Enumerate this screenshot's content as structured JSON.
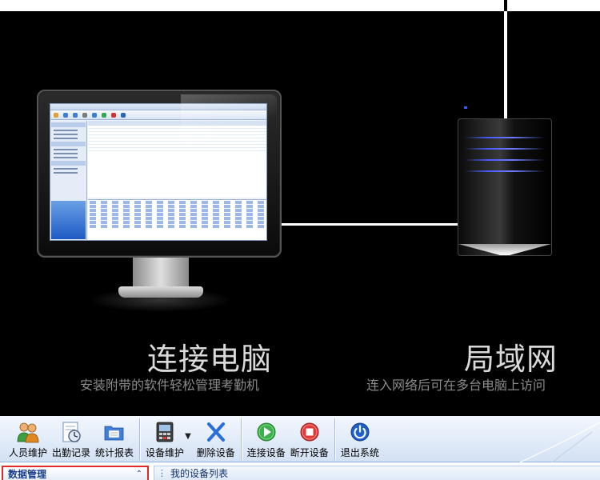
{
  "promo": {
    "left": {
      "title": "连接电脑",
      "subtitle": "安装附带的软件轻松管理考勤机"
    },
    "right": {
      "title": "局域网",
      "subtitle": "连入网络后可在多台电脑上访问"
    }
  },
  "toolbar": {
    "groups": [
      [
        {
          "name": "personnel-button",
          "label": "人员维护",
          "icon": "people-icon"
        },
        {
          "name": "attendance-record-button",
          "label": "出勤记录",
          "icon": "clock-document-icon"
        },
        {
          "name": "stats-report-button",
          "label": "统计报表",
          "icon": "folder-report-icon"
        }
      ],
      [
        {
          "name": "device-maintenance-button",
          "label": "设备维护",
          "icon": "attendance-device-icon"
        },
        {
          "name": "delete-device-button",
          "label": "删除设备",
          "icon": "blue-x-icon"
        }
      ],
      [
        {
          "name": "connect-device-button",
          "label": "连接设备",
          "icon": "green-play-icon"
        },
        {
          "name": "disconnect-device-button",
          "label": "断开设备",
          "icon": "red-stop-icon"
        }
      ],
      [
        {
          "name": "exit-system-button",
          "label": "退出系统",
          "icon": "power-icon"
        }
      ]
    ]
  },
  "panels": {
    "left_title": "数据管理",
    "right_title": "我的设备列表"
  },
  "colors": {
    "highlight_border": "#e02a2a",
    "toolbar_top": "#f3f7fd",
    "toolbar_bottom": "#d3e1f4"
  }
}
